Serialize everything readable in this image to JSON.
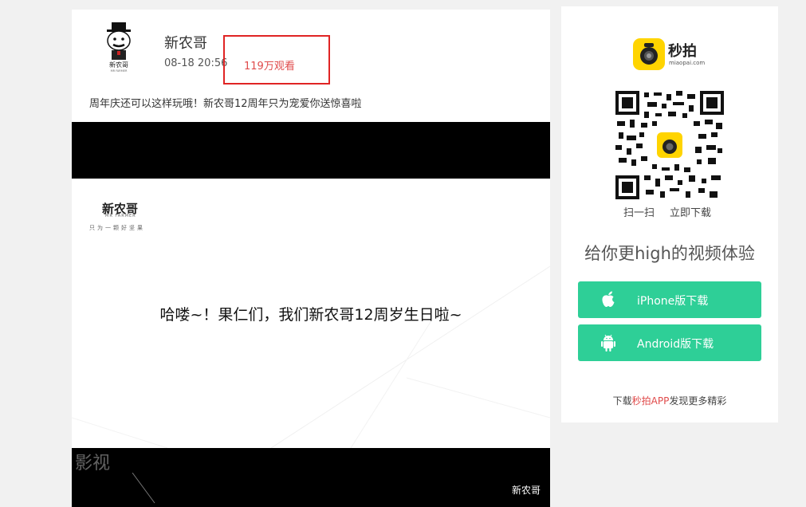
{
  "post": {
    "author": "新农哥",
    "time": "08-18 20:56",
    "views": "119万观看",
    "caption": "周年庆还可以这样玩哦！新农哥12周年只为宠爱你送惊喜啦"
  },
  "mascot": {
    "label": "新农哥",
    "sublabel": "MR FARMER"
  },
  "video": {
    "brand_logo": "新农哥",
    "brand_sub": "MR FARMER",
    "brand_slogan": "只为一颗好坚果",
    "frame_text": "哈喽~！果仁们，我们新农哥12周岁生日啦~",
    "watermark": "影视",
    "tag": "新农哥"
  },
  "app": {
    "name": "秒拍",
    "domain": "miaopai.com",
    "scan_label": "扫一扫",
    "download_label": "立即下载",
    "tagline": "给你更high的视频体验",
    "iphone_button": "iPhone版下载",
    "android_button": "Android版下载",
    "footer_pre": "下载",
    "footer_accent": "秒拍APP",
    "footer_post": "发现更多精彩",
    "brand_color": "#2ecf97",
    "logo_color": "#ffd400"
  }
}
